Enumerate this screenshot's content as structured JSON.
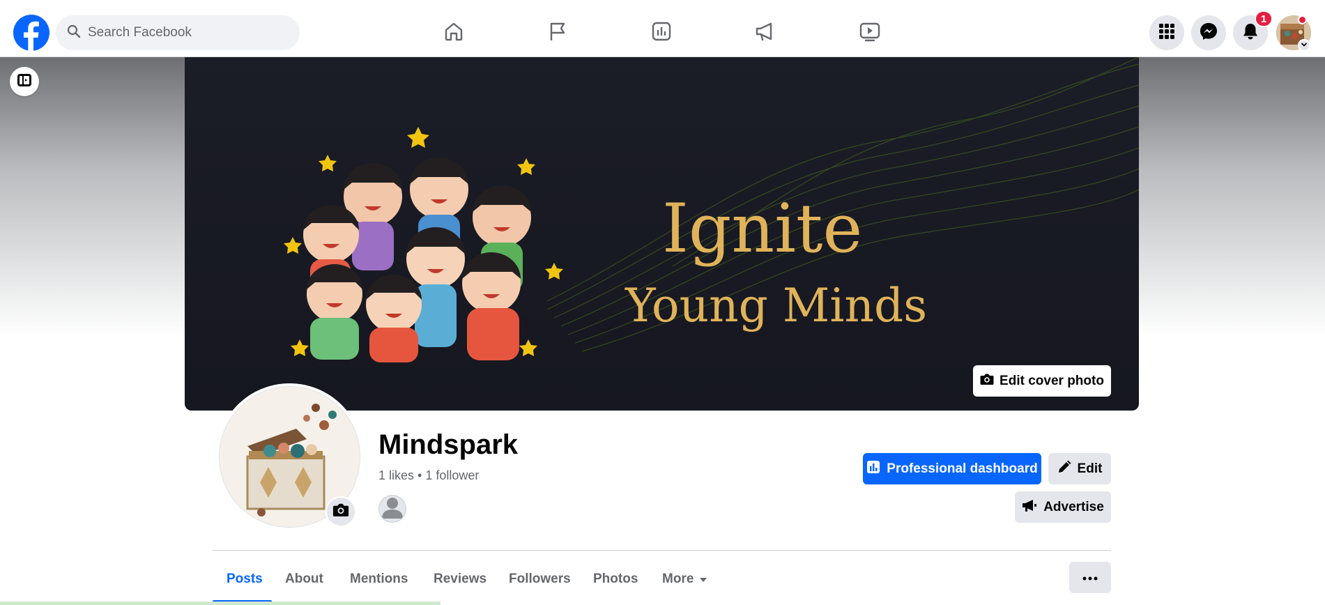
{
  "topbar": {
    "search_placeholder": "Search Facebook",
    "notifications_count": "1",
    "nav": [
      "home-icon",
      "flag-icon",
      "insights-icon",
      "megaphone-icon",
      "video-icon"
    ],
    "actions": [
      "menu-grid-icon",
      "messenger-icon",
      "bell-icon"
    ]
  },
  "cover": {
    "line1": "Ignite",
    "line2": "Young Minds",
    "edit_label": "Edit cover photo"
  },
  "profile": {
    "name": "Mindspark",
    "stats": "1 likes • 1 follower"
  },
  "actions": {
    "dashboard_label": "Professional dashboard",
    "edit_label": "Edit",
    "advertise_label": "Advertise"
  },
  "tabs": [
    {
      "label": "Posts",
      "active": true
    },
    {
      "label": "About"
    },
    {
      "label": "Mentions"
    },
    {
      "label": "Reviews"
    },
    {
      "label": "Followers"
    },
    {
      "label": "Photos"
    },
    {
      "label": "More"
    }
  ],
  "colors": {
    "brand": "#0866ff",
    "badge": "#e41e3f",
    "cover_text": "#e0b35a",
    "cover_bg": "#1b1d27"
  }
}
